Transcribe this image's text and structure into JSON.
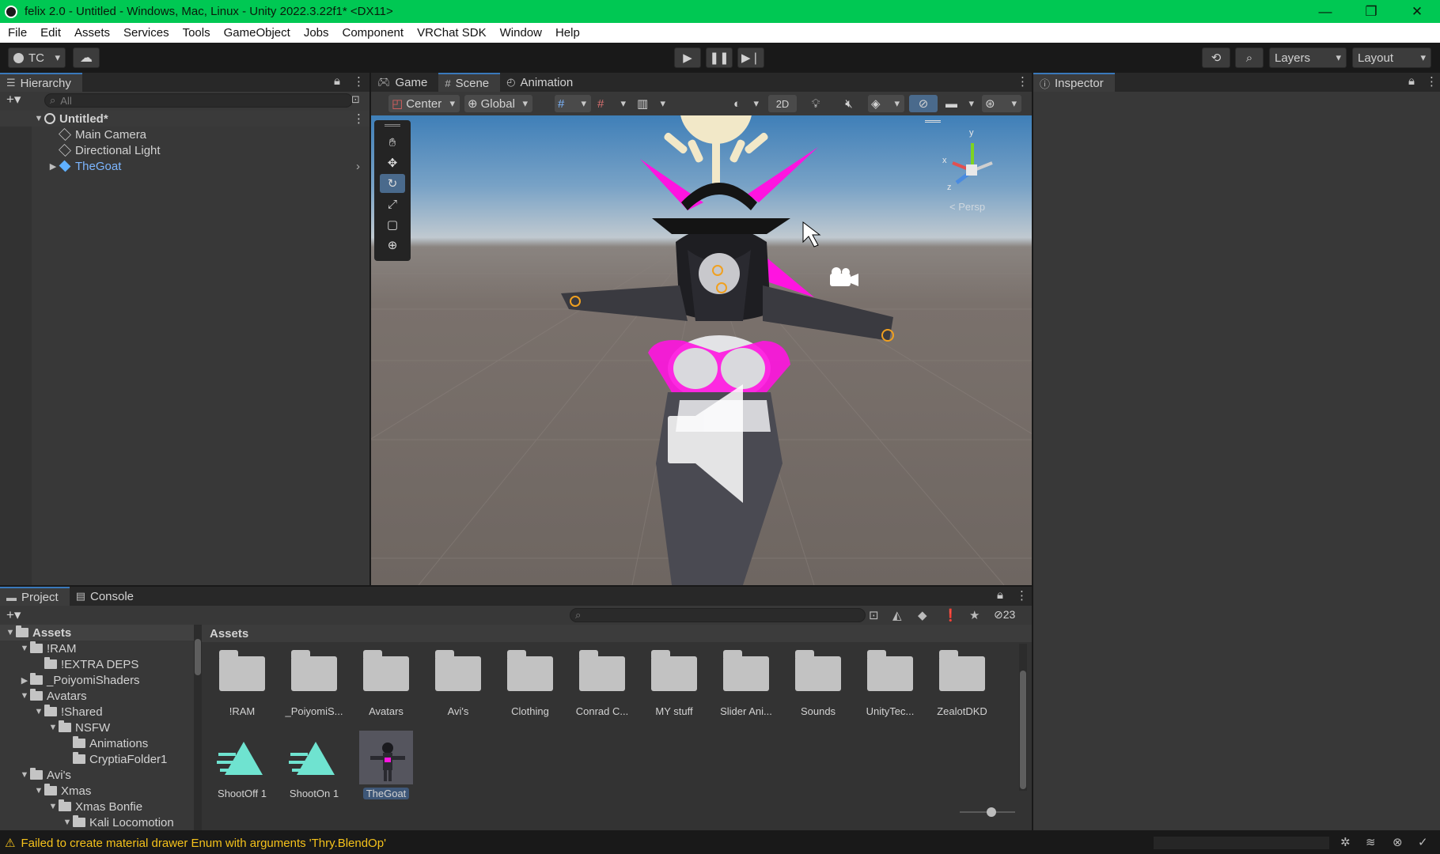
{
  "window": {
    "title": "felix 2.0 - Untitled - Windows, Mac, Linux - Unity 2022.3.22f1* <DX11>",
    "controls": [
      "—",
      "❐",
      "✕"
    ]
  },
  "menu": [
    "File",
    "Edit",
    "Assets",
    "Services",
    "Tools",
    "GameObject",
    "Jobs",
    "Component",
    "VRChat SDK",
    "Window",
    "Help"
  ],
  "toolbar": {
    "account": "TC",
    "layers": "Layers",
    "layout": "Layout"
  },
  "hierarchy": {
    "tab": "Hierarchy",
    "search_placeholder": "All",
    "scene": "Untitled*",
    "items": [
      "Main Camera",
      "Directional Light",
      "TheGoat"
    ]
  },
  "scene_view": {
    "tabs": [
      "Game",
      "Scene",
      "Animation"
    ],
    "active_tab": "Scene",
    "pivot": "Center",
    "space": "Global",
    "mode_2d": "2D",
    "persp": "< Persp"
  },
  "inspector": {
    "tab": "Inspector"
  },
  "project": {
    "tabs": [
      "Project",
      "Console"
    ],
    "hidden_count": "23",
    "tree": [
      {
        "label": "Assets",
        "depth": 0,
        "arrow": "▼",
        "bold": true
      },
      {
        "label": "!RAM",
        "depth": 1,
        "arrow": "▼"
      },
      {
        "label": "!EXTRA DEPS",
        "depth": 2,
        "arrow": ""
      },
      {
        "label": "_PoiyomiShaders",
        "depth": 1,
        "arrow": "▶"
      },
      {
        "label": "Avatars",
        "depth": 1,
        "arrow": "▼"
      },
      {
        "label": "!Shared",
        "depth": 2,
        "arrow": "▼"
      },
      {
        "label": "NSFW",
        "depth": 3,
        "arrow": "▼"
      },
      {
        "label": "Animations",
        "depth": 4,
        "arrow": ""
      },
      {
        "label": "CryptiaFolder1",
        "depth": 4,
        "arrow": ""
      },
      {
        "label": "Avi's",
        "depth": 1,
        "arrow": "▼"
      },
      {
        "label": "Xmas",
        "depth": 2,
        "arrow": "▼"
      },
      {
        "label": "Xmas Bonfie",
        "depth": 3,
        "arrow": "▼"
      },
      {
        "label": "Kali Locomotion",
        "depth": 4,
        "arrow": "▼"
      }
    ],
    "breadcrumb": "Assets",
    "folders": [
      "!RAM",
      "_PoiyomiS...",
      "Avatars",
      "Avi's",
      "Clothing",
      "Conrad C...",
      "MY stuff",
      "Slider Ani...",
      "Sounds",
      "UnityTec...",
      "ZealotDKD"
    ],
    "files": [
      "ShootOff 1",
      "ShootOn 1",
      "TheGoat"
    ]
  },
  "status": {
    "message": "Failed to create material drawer Enum with arguments 'Thry.BlendOp'"
  },
  "colors": {
    "titlebar": "#00c853",
    "accent": "#3a79bb",
    "warning": "#f5c21b",
    "magenta": "#ff14e0"
  }
}
